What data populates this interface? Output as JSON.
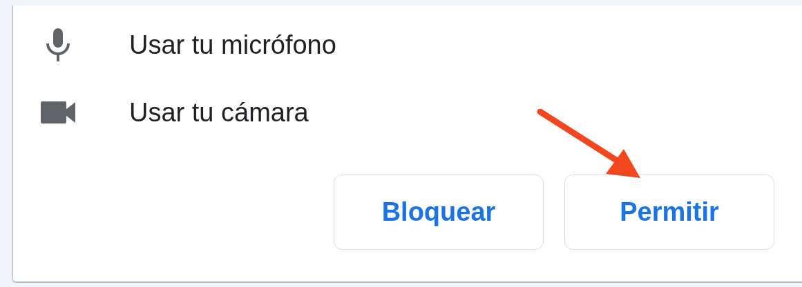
{
  "permissions": [
    {
      "kind": "microphone",
      "label": "Usar tu micrófono"
    },
    {
      "kind": "camera",
      "label": "Usar tu cámara"
    }
  ],
  "buttons": [
    "Bloquear",
    "Permitir"
  ]
}
